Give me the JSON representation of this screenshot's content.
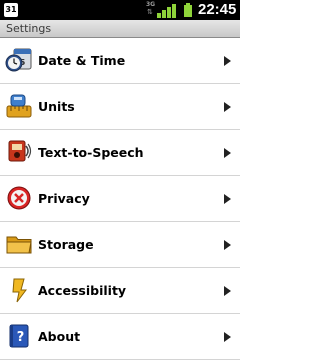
{
  "status_bar": {
    "calendar_badge": "31",
    "network": "3G",
    "time": "22:45"
  },
  "title_bar": {
    "title": "Settings"
  },
  "items": [
    {
      "label": "Date & Time",
      "icon": "clock-calendar-icon"
    },
    {
      "label": "Units",
      "icon": "units-icon"
    },
    {
      "label": "Text-to-Speech",
      "icon": "speech-icon"
    },
    {
      "label": "Privacy",
      "icon": "privacy-icon"
    },
    {
      "label": "Storage",
      "icon": "folder-icon"
    },
    {
      "label": "Accessibility",
      "icon": "accessibility-icon"
    },
    {
      "label": "About",
      "icon": "help-book-icon"
    }
  ]
}
